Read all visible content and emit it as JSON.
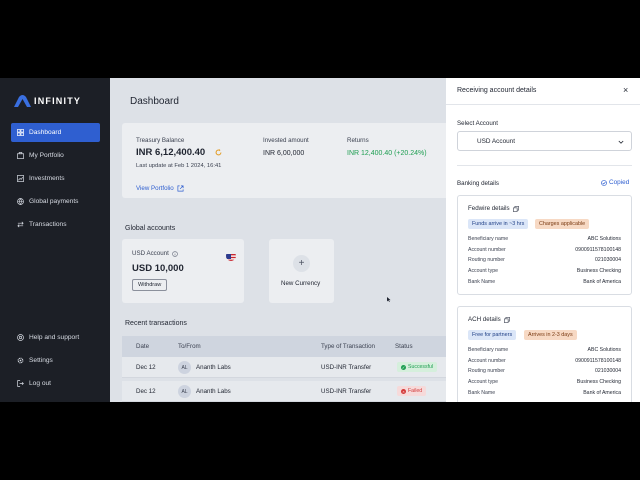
{
  "app": {
    "logo_text": "INFINITY"
  },
  "sidebar": {
    "items": [
      {
        "label": "Dashboard",
        "icon": "dashboard-icon",
        "active": true
      },
      {
        "label": "My Portfolio",
        "icon": "portfolio-icon"
      },
      {
        "label": "Investments",
        "icon": "investments-icon"
      },
      {
        "label": "Global payments",
        "icon": "globe-icon"
      },
      {
        "label": "Transactions",
        "icon": "transfer-icon"
      }
    ],
    "bottom_items": [
      {
        "label": "Help and support",
        "icon": "help-icon"
      },
      {
        "label": "Settings",
        "icon": "gear-icon"
      },
      {
        "label": "Log out",
        "icon": "logout-icon"
      }
    ]
  },
  "main": {
    "title": "Dashboard",
    "treasury": {
      "balance_label": "Treasury Balance",
      "balance_value": "INR 6,12,400.40",
      "last_update": "Last update at Feb 1 2024, 16:41",
      "invested_label": "Invested amount",
      "invested_value": "INR 6,00,000",
      "returns_label": "Returns",
      "returns_value": "INR 12,400.40 (+20.24%)",
      "view_portfolio": "View Portfolio"
    },
    "global_accounts": {
      "title": "Global accounts",
      "account_name": "USD Account",
      "account_balance": "USD 10,000",
      "withdraw_label": "Withdraw",
      "new_currency_label": "New Currency"
    },
    "recent_transactions": {
      "title": "Recent transactions",
      "columns": [
        "Date",
        "To/From",
        "Type of Transaction",
        "Status"
      ],
      "rows": [
        {
          "date": "Dec 12",
          "initials": "AL",
          "name": "Ananth Labs",
          "type": "USD-INR Transfer",
          "status": "Successful"
        },
        {
          "date": "Dec 12",
          "initials": "AL",
          "name": "Ananth Labs",
          "type": "USD-INR Transfer",
          "status": "Failed"
        }
      ]
    }
  },
  "panel": {
    "title": "Receiving account details",
    "close": "×",
    "select_label": "Select Account",
    "select_value": "USD Account",
    "banking_title": "Banking details",
    "copied_label": "Copied",
    "fedwire": {
      "title": "Fedwire details",
      "tags": [
        "Funds arrive in ~3 hrs",
        "Charges applicable"
      ],
      "rows": [
        {
          "label": "Beneficiary name",
          "value": "ABC Solutions"
        },
        {
          "label": "Account number",
          "value": "0900911578100148"
        },
        {
          "label": "Routing number",
          "value": "021030004"
        },
        {
          "label": "Account type",
          "value": "Business Checking"
        },
        {
          "label": "Bank Name",
          "value": "Bank of America"
        }
      ]
    },
    "ach": {
      "title": "ACH details",
      "tags": [
        "Free for partners",
        "Arrives in 2-3 days"
      ],
      "rows": [
        {
          "label": "Beneficiary name",
          "value": "ABC Solutions"
        },
        {
          "label": "Account number",
          "value": "0900911578100148"
        },
        {
          "label": "Routing number",
          "value": "021030004"
        },
        {
          "label": "Account type",
          "value": "Business Checking"
        },
        {
          "label": "Bank Name",
          "value": "Bank of America"
        }
      ]
    }
  },
  "colors": {
    "accent": "#2f5fd0",
    "sidebar_bg": "#1c1f26",
    "success": "#1e9e52",
    "failed": "#d33a3a"
  }
}
